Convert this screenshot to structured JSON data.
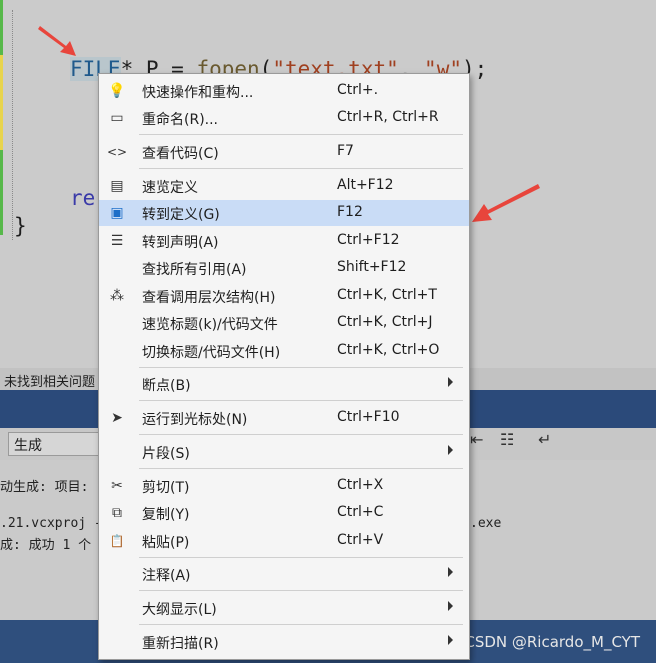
{
  "editor": {
    "line1": {
      "type": "FILE",
      "rest_a": "* P = ",
      "fn": "fopen",
      "rest_b": "(",
      "str1": "\"text.txt\"",
      "rest_c": ", ",
      "str2": "\"w\"",
      "rest_d": ");"
    },
    "line2": "re",
    "line3": "}"
  },
  "status_text": "未找到相关问题",
  "output": {
    "combo_value": "生成",
    "lines": [
      "动生成: 项目:",
      ".21.vcxproj -",
      "成: 成功 1 个"
    ],
    "exe_suffix": ".exe"
  },
  "watermark": "CSDN @Ricardo_M_CYT",
  "menu": {
    "items": [
      {
        "icon": "lightbulb-icon",
        "glyph": "💡",
        "label": "快速操作和重构...",
        "shortcut": "Ctrl+."
      },
      {
        "icon": "rename-icon",
        "glyph": "▭",
        "label": "重命名(R)...",
        "shortcut": "Ctrl+R, Ctrl+R"
      },
      {
        "icon": "code-icon",
        "glyph": "<>",
        "label": "查看代码(C)",
        "shortcut": "F7"
      },
      {
        "icon": "peek-definition-icon",
        "glyph": "▤",
        "label": "速览定义",
        "shortcut": "Alt+F12"
      },
      {
        "icon": "goto-definition-icon",
        "glyph": "▣",
        "label": "转到定义(G)",
        "shortcut": "F12"
      },
      {
        "icon": "goto-declaration-icon",
        "glyph": "☰",
        "label": "转到声明(A)",
        "shortcut": "Ctrl+F12"
      },
      {
        "icon": "",
        "glyph": "",
        "label": "查找所有引用(A)",
        "shortcut": "Shift+F12"
      },
      {
        "icon": "call-hierarchy-icon",
        "glyph": "⁂",
        "label": "查看调用层次结构(H)",
        "shortcut": "Ctrl+K, Ctrl+T"
      },
      {
        "icon": "",
        "glyph": "",
        "label": "速览标题(k)/代码文件",
        "shortcut": "Ctrl+K, Ctrl+J"
      },
      {
        "icon": "",
        "glyph": "",
        "label": "切换标题/代码文件(H)",
        "shortcut": "Ctrl+K, Ctrl+O"
      },
      {
        "icon": "",
        "glyph": "",
        "label": "断点(B)",
        "shortcut": ""
      },
      {
        "icon": "cursor-icon",
        "glyph": "➤",
        "label": "运行到光标处(N)",
        "shortcut": "Ctrl+F10"
      },
      {
        "icon": "",
        "glyph": "",
        "label": "片段(S)",
        "shortcut": ""
      },
      {
        "icon": "scissors-icon",
        "glyph": "✂",
        "label": "剪切(T)",
        "shortcut": "Ctrl+X"
      },
      {
        "icon": "copy-icon",
        "glyph": "⧉",
        "label": "复制(Y)",
        "shortcut": "Ctrl+C"
      },
      {
        "icon": "paste-icon",
        "glyph": "📋",
        "label": "粘贴(P)",
        "shortcut": "Ctrl+V"
      },
      {
        "icon": "",
        "glyph": "",
        "label": "注释(A)",
        "shortcut": ""
      },
      {
        "icon": "",
        "glyph": "",
        "label": "大纲显示(L)",
        "shortcut": ""
      },
      {
        "icon": "",
        "glyph": "",
        "label": "重新扫描(R)",
        "shortcut": ""
      }
    ],
    "highlighted_label": "转到定义(G)"
  },
  "colors": {
    "menu_highlight": "#c9dcf6",
    "annotation_arrow": "#e8453c"
  }
}
